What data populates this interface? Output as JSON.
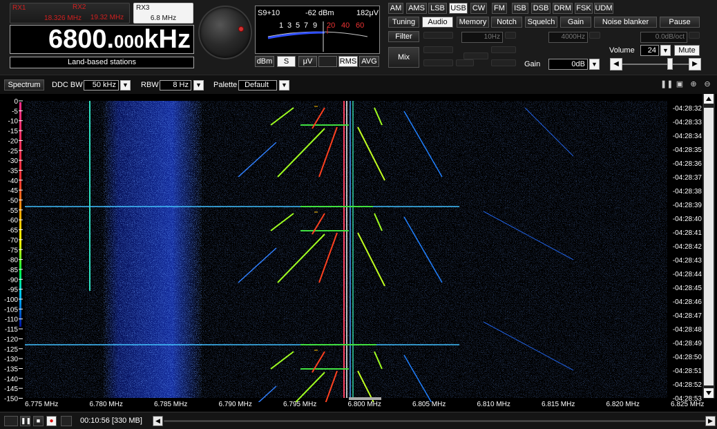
{
  "receivers": [
    {
      "name": "RX1",
      "freq": "18.326 MHz",
      "active": false
    },
    {
      "name": "RX2",
      "freq": "19.32 MHz",
      "active": false
    },
    {
      "name": "RX3",
      "freq": "6.8 MHz",
      "active": true
    }
  ],
  "frequency": {
    "main": "6800.",
    "fraction": "000",
    "unit": "kHz"
  },
  "station_label": "Land-based stations",
  "smeter": {
    "s_reading": "S9+10",
    "dbm_reading": "-62 dBm",
    "uv_reading": "182μV",
    "scale_white": [
      "1",
      "3",
      "5",
      "7",
      "9"
    ],
    "scale_red": [
      "20",
      "40",
      "60"
    ],
    "buttons": [
      "dBm",
      "S",
      "μV"
    ],
    "active_unit": "S",
    "rms_label": "RMS",
    "avg_label": "AVG"
  },
  "modes": [
    "AM",
    "AMS",
    "LSB",
    "USB",
    "CW",
    "FM",
    "ISB",
    "DSB",
    "DRM",
    "FSK",
    "UDM"
  ],
  "active_mode": "USB",
  "function_tabs": [
    "Tuning",
    "Audio",
    "Memory",
    "Notch",
    "Squelch",
    "Gain",
    "Noise blanker",
    "Pause"
  ],
  "active_tab": "Audio",
  "audio": {
    "filter_label": "Filter",
    "mix_label": "Mix",
    "low_cut": "10Hz",
    "high_cut": "4000Hz",
    "slope": "0.0dB/oct",
    "gain_label": "Gain",
    "gain_value": "0dB",
    "volume_label": "Volume",
    "volume_value": "24",
    "mute_label": "Mute",
    "volume_level": 0.86
  },
  "spectrum_toolbar": {
    "spectrum_label": "Spectrum",
    "ddc_bw_label": "DDC BW",
    "ddc_bw_value": "50 kHz",
    "rbw_label": "RBW",
    "rbw_value": "8 Hz",
    "palette_label": "Palette",
    "palette_value": "Default"
  },
  "waterfall": {
    "db_ticks": [
      "0",
      "-5",
      "-10",
      "-15",
      "-20",
      "-25",
      "-30",
      "-35",
      "-40",
      "-45",
      "-50",
      "-55",
      "-60",
      "-65",
      "-70",
      "-75",
      "-80",
      "-85",
      "-90",
      "-95",
      "-100",
      "-105",
      "-110",
      "-115",
      "-120",
      "-125",
      "-130",
      "-135",
      "-140",
      "-145",
      "-150"
    ],
    "time_ticks": [
      "-04:28:32",
      "-04:28:33",
      "-04:28:34",
      "-04:28:35",
      "-04:28:36",
      "-04:28:37",
      "-04:28:38",
      "-04:28:39",
      "-04:28:40",
      "-04:28:41",
      "-04:28:42",
      "-04:28:43",
      "-04:28:44",
      "-04:28:45",
      "-04:28:46",
      "-04:28:47",
      "-04:28:48",
      "-04:28:49",
      "-04:28:50",
      "-04:28:51",
      "-04:28:52",
      "-04:28:53"
    ],
    "freq_ticks": [
      "6.775 MHz",
      "6.780 MHz",
      "6.785 MHz",
      "6.790 MHz",
      "6.795 MHz",
      "6.800 MHz",
      "6.805 MHz",
      "6.810 MHz",
      "6.815 MHz",
      "6.820 MHz",
      "6.825 MHz"
    ]
  },
  "recorder": {
    "time": "00:10:56",
    "size": "[330 MB]"
  }
}
